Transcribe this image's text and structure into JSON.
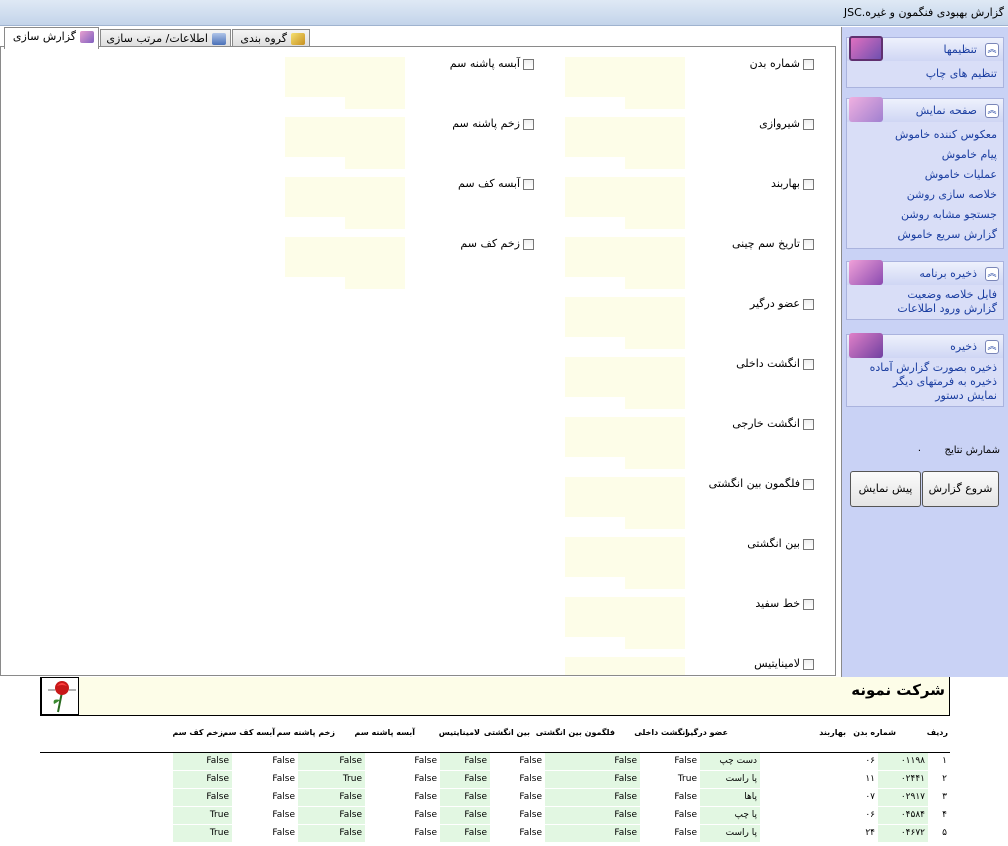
{
  "window": {
    "title": "گزارش بهبودی فنگمون و غیره.JSC"
  },
  "tabs": [
    {
      "label": "گزارش سازی",
      "active": true
    },
    {
      "label": "اطلاعات/ مرتب سازی",
      "active": false
    },
    {
      "label": "گروه بندی",
      "active": false
    }
  ],
  "fields_col1": [
    {
      "label": "شماره بدن",
      "checked": false
    },
    {
      "label": "شیروازی",
      "checked": false
    },
    {
      "label": "بهاربند",
      "checked": false
    },
    {
      "label": "تاریخ سم چینی",
      "checked": false
    },
    {
      "label": "عضو درگیر",
      "checked": false
    },
    {
      "label": "انگشت داخلی",
      "checked": false
    },
    {
      "label": "انگشت خارجی",
      "checked": false
    },
    {
      "label": "فلگمون بین انگشتی",
      "checked": false
    },
    {
      "label": "بین انگشتی",
      "checked": false
    },
    {
      "label": "خط سفید",
      "checked": false
    },
    {
      "label": "لامینایتیس",
      "checked": false
    }
  ],
  "fields_col2": [
    {
      "label": "آبسه پاشنه سم",
      "checked": false
    },
    {
      "label": "زخم پاشنه سم",
      "checked": false
    },
    {
      "label": "آبسه کف سم",
      "checked": false
    },
    {
      "label": "زخم کف سم",
      "checked": false
    }
  ],
  "side": {
    "groups": [
      {
        "title": "تنظیمها",
        "icon": "settings-gear-icon",
        "items": [
          "تنظیم های چاپ"
        ]
      },
      {
        "title": "صفحه نمایش",
        "icon": "display-screen-icon",
        "items": [
          "معکوس کننده خاموش",
          "پیام خاموش",
          "عملیات خاموش",
          "خلاصه سازی روشن",
          "جستجو مشابه روشن",
          "گزارش سریع خاموش"
        ]
      },
      {
        "title": "ذخیره برنامه",
        "icon": "save-program-icon",
        "items": [
          "فایل خلاصه وضعیت",
          "گزارش ورود اطلاعات"
        ]
      },
      {
        "title": "ذخیره",
        "icon": "save-disk-icon",
        "items": [
          "ذخیره بصورت گزارش آماده",
          "ذخیره به فرمتهای دیگر",
          "نمایش دستور"
        ]
      }
    ],
    "counter_label": "شمارش نتایج",
    "counter_value": "۰",
    "start_button": "شروع گزارش",
    "preview_button": "پیش نمایش"
  },
  "report": {
    "company": "شرکت نمونه",
    "columns": [
      "ردیف",
      "شماره بدن",
      "بهاربند",
      "عضو درگیر",
      "انگشت داخلی",
      "فلگمون بین انگشتی",
      "بین انگشتی",
      "لامینایتیس",
      "آبسه پاشنه سم",
      "زخم پاشنه سم",
      "آبسه کف سم",
      "زخم کف سم"
    ],
    "rows": [
      {
        "n": "۱",
        "body": "۰۱۱۹۸",
        "barn": "۰۶",
        "member": "دست چپ",
        "inner": "False",
        "phleg": "False",
        "between": "False",
        "lamin": "False",
        "heel_abs": "False",
        "heel_wound": "False",
        "sole_abs": "False",
        "sole_wound": "False"
      },
      {
        "n": "۲",
        "body": "۰۲۴۴۱",
        "barn": "۱۱",
        "member": "پا راست",
        "inner": "True",
        "phleg": "False",
        "between": "False",
        "lamin": "False",
        "heel_abs": "False",
        "heel_wound": "True",
        "sole_abs": "False",
        "sole_wound": "False"
      },
      {
        "n": "۳",
        "body": "۰۲۹۱۷",
        "barn": "۰۷",
        "member": "پاها",
        "inner": "False",
        "phleg": "False",
        "between": "False",
        "lamin": "False",
        "heel_abs": "False",
        "heel_wound": "False",
        "sole_abs": "False",
        "sole_wound": "False"
      },
      {
        "n": "۴",
        "body": "۰۴۵۸۴",
        "barn": "۰۶",
        "member": "پا چپ",
        "inner": "False",
        "phleg": "False",
        "between": "False",
        "lamin": "False",
        "heel_abs": "False",
        "heel_wound": "False",
        "sole_abs": "False",
        "sole_wound": "True"
      },
      {
        "n": "۵",
        "body": "۰۴۶۷۲",
        "barn": "۲۴",
        "member": "پا راست",
        "inner": "False",
        "phleg": "False",
        "between": "False",
        "lamin": "False",
        "heel_abs": "False",
        "heel_wound": "False",
        "sole_abs": "False",
        "sole_wound": "True"
      }
    ]
  },
  "colors": {
    "panel": "#c9d2f5",
    "link": "#1a3da0",
    "report_header": "#fdfde8",
    "green_cell": "#e2f7e2"
  }
}
